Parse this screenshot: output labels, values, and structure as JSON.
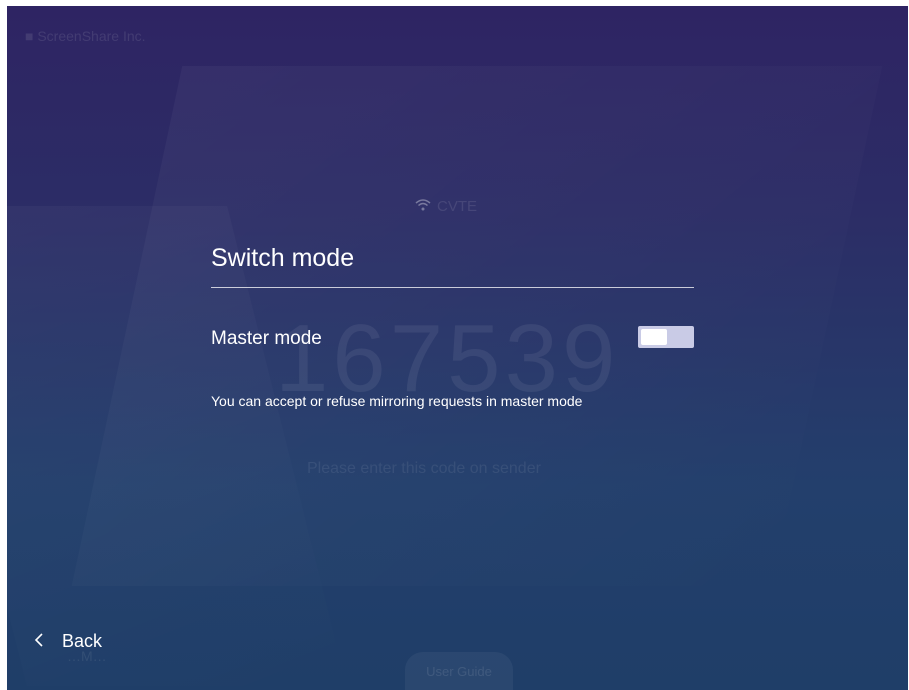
{
  "background": {
    "logo_text": "■ ScreenShare Inc.",
    "wifi_icon": "wifi-icon",
    "network_name": "CVTE",
    "pair_code": "167539",
    "hint": "Please enter this code on sender",
    "footer_left": "…M…",
    "guide_label": "User Guide"
  },
  "dialog": {
    "title": "Switch mode",
    "master_mode_label": "Master mode",
    "master_mode_enabled": false,
    "description": "You can accept or refuse mirroring requests in master mode"
  },
  "nav": {
    "back_icon": "chevron-left-icon",
    "back_label": "Back"
  },
  "colors": {
    "bg_top": "#2e2463",
    "bg_bottom": "#1f3e68",
    "toggle_track": "#c9cbe6",
    "text": "#ffffff"
  }
}
